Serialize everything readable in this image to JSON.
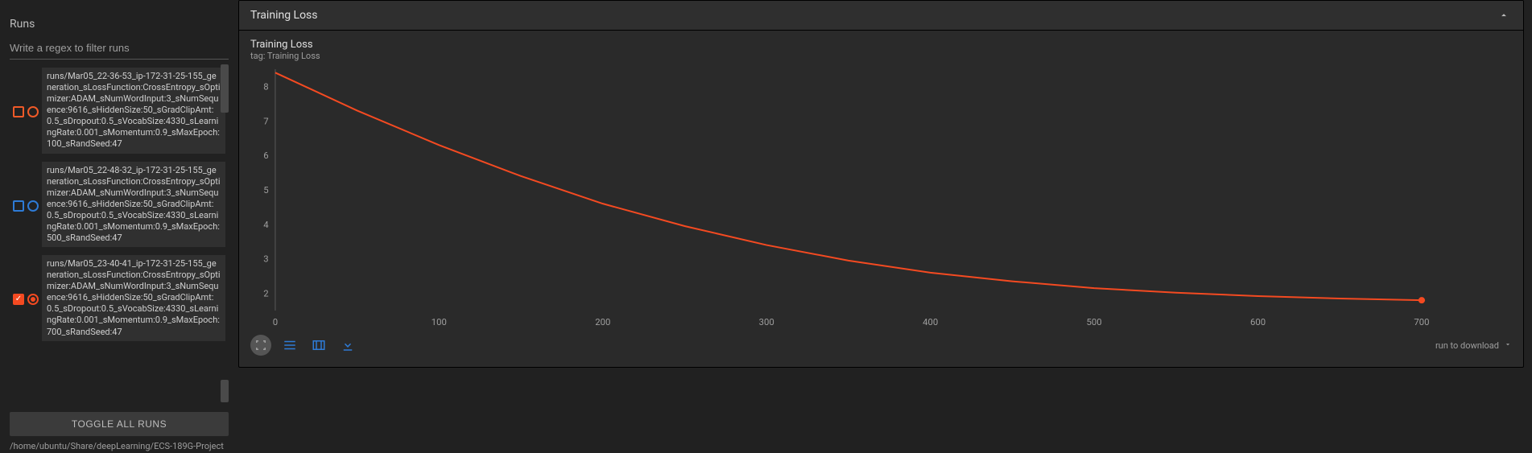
{
  "sidebar": {
    "section_label": "Runs",
    "filter_placeholder": "Write a regex to filter runs",
    "runs": [
      {
        "checked": false,
        "color": "#f05a28",
        "label": "runs/Mar05_22-36-53_ip-172-31-25-155_generation_sLossFunction:CrossEntropy_sOptimizer:ADAM_sNumWordInput:3_sNumSequence:9616_sHiddenSize:50_sGradClipAmt:0.5_sDropout:0.5_sVocabSize:4330_sLearningRate:0.001_sMomentum:0.9_sMaxEpoch:100_sRandSeed:47"
      },
      {
        "checked": false,
        "color": "#2e7bd6",
        "label": "runs/Mar05_22-48-32_ip-172-31-25-155_generation_sLossFunction:CrossEntropy_sOptimizer:ADAM_sNumWordInput:3_sNumSequence:9616_sHiddenSize:50_sGradClipAmt:0.5_sDropout:0.5_sVocabSize:4330_sLearningRate:0.001_sMomentum:0.9_sMaxEpoch:500_sRandSeed:47"
      },
      {
        "checked": true,
        "color": "#f44a21",
        "label": "runs/Mar05_23-40-41_ip-172-31-25-155_generation_sLossFunction:CrossEntropy_sOptimizer:ADAM_sNumWordInput:3_sNumSequence:9616_sHiddenSize:50_sGradClipAmt:0.5_sDropout:0.5_sVocabSize:4330_sLearningRate:0.001_sMomentum:0.9_sMaxEpoch:700_sRandSeed:47"
      }
    ],
    "toggle_label": "TOGGLE ALL RUNS",
    "path": "/home/ubuntu/Share/deepLearning/ECS-189G-Project"
  },
  "panel": {
    "title": "Training Loss",
    "chart_title": "Training Loss",
    "chart_subtitle": "tag: Training Loss",
    "download_label": "run to download"
  },
  "chart_data": {
    "type": "line",
    "title": "Training Loss",
    "xlabel": "",
    "ylabel": "",
    "xlim": [
      0,
      750
    ],
    "ylim": [
      1.5,
      8.5
    ],
    "y_ticks": [
      2,
      3,
      4,
      5,
      6,
      7,
      8
    ],
    "x_ticks": [
      0,
      100,
      200,
      300,
      400,
      500,
      600,
      700
    ],
    "series": [
      {
        "name": "MaxEpoch:700",
        "color": "#f44a21",
        "x": [
          0,
          50,
          100,
          150,
          200,
          250,
          300,
          350,
          400,
          450,
          500,
          550,
          600,
          650,
          700
        ],
        "values": [
          8.4,
          7.3,
          6.3,
          5.4,
          4.6,
          3.95,
          3.4,
          2.95,
          2.6,
          2.35,
          2.15,
          2.02,
          1.92,
          1.85,
          1.8
        ]
      }
    ]
  }
}
